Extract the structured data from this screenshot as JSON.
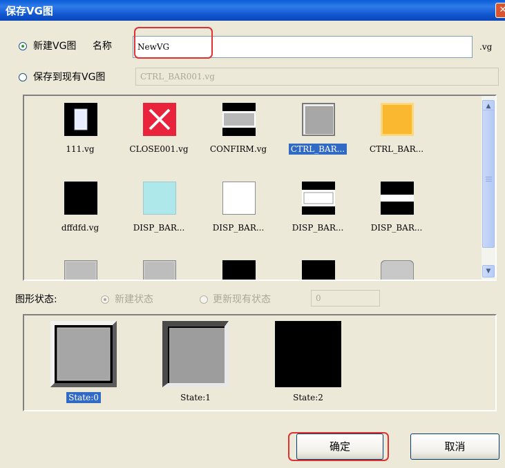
{
  "title": "保存VG图",
  "close_glyph": "✕",
  "mode": {
    "new_label": "新建VG图",
    "name_label": "名称",
    "name_value": "NewVG",
    "suffix": ".vg",
    "existing_label": "保存到现有VG图",
    "existing_value": "CTRL_BAR001.vg"
  },
  "items": [
    {
      "label": "111.vg",
      "icon": "white-rect-black-frame"
    },
    {
      "label": "CLOSE001.vg",
      "icon": "red-x"
    },
    {
      "label": "CONFIRM.vg",
      "icon": "gray-band"
    },
    {
      "label": "CTRL_BAR...",
      "icon": "gray-button",
      "selected": true
    },
    {
      "label": "CTRL_BAR...",
      "icon": "orange-button"
    },
    {
      "label": "dffdfd.vg",
      "icon": "black-square"
    },
    {
      "label": "DISP_BAR...",
      "icon": "cyan-square"
    },
    {
      "label": "DISP_BAR...",
      "icon": "white-square"
    },
    {
      "label": "DISP_BAR...",
      "icon": "white-band"
    },
    {
      "label": "DISP_BAR...",
      "icon": "white-stripe"
    },
    {
      "label": "",
      "icon": "gray-partial"
    },
    {
      "label": "",
      "icon": "gray-partial"
    },
    {
      "label": "",
      "icon": "black-partial"
    },
    {
      "label": "",
      "icon": "black-partial"
    },
    {
      "label": "",
      "icon": "gray-round-partial"
    }
  ],
  "state_section": {
    "label": "图形状态:",
    "new_state": "新建状态",
    "update_state": "更新现有状态",
    "index_value": "0"
  },
  "states": [
    {
      "label": "State:0",
      "icon": "raised-gray",
      "selected": true
    },
    {
      "label": "State:1",
      "icon": "sunken-gray"
    },
    {
      "label": "State:2",
      "icon": "black"
    }
  ],
  "buttons": {
    "ok": "确定",
    "cancel": "取消"
  },
  "colors": {
    "highlight": "#e03030",
    "selection": "#316ac5"
  }
}
